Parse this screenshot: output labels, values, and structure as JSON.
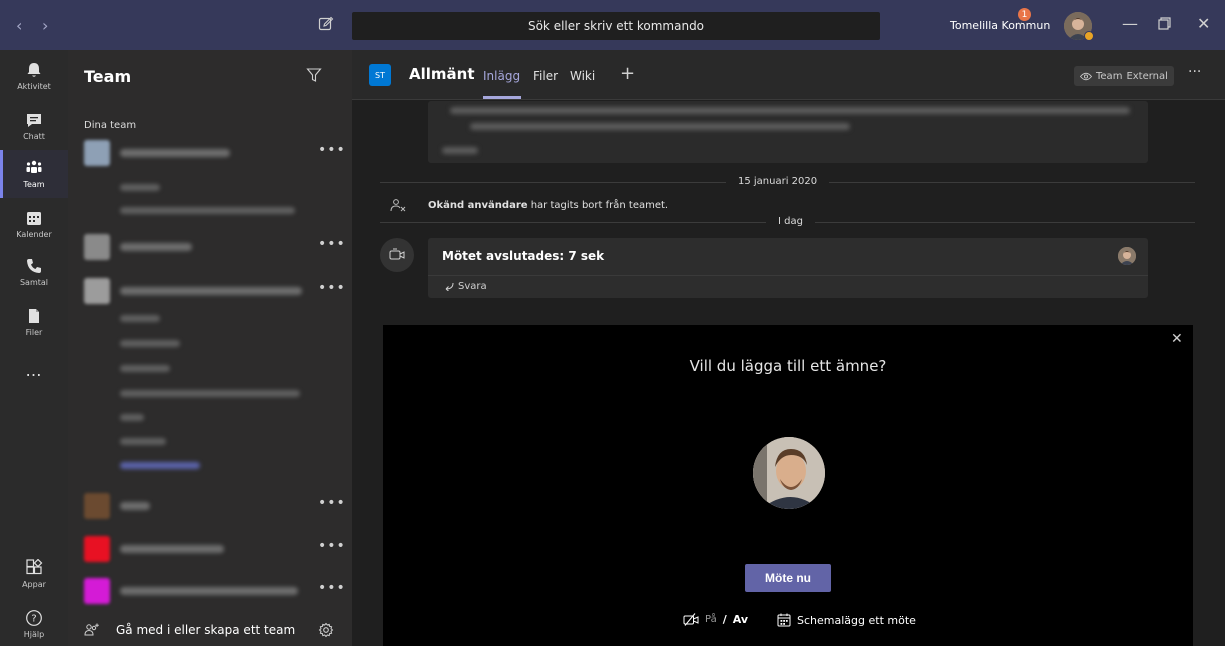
{
  "titlebar": {
    "search_placeholder": "Sök eller skriv ett kommando",
    "tenant": "Tomelilla Kommun",
    "notification_count": "1"
  },
  "rail": {
    "items": [
      {
        "label": "Aktivitet",
        "icon": "bell-icon"
      },
      {
        "label": "Chatt",
        "icon": "chat-icon"
      },
      {
        "label": "Team",
        "icon": "teams-icon"
      },
      {
        "label": "Kalender",
        "icon": "calendar-icon"
      },
      {
        "label": "Samtal",
        "icon": "phone-icon"
      },
      {
        "label": "Filer",
        "icon": "file-icon"
      },
      {
        "label": "…",
        "icon": "more-icon"
      }
    ],
    "bottom": [
      {
        "label": "Appar",
        "icon": "apps-icon"
      },
      {
        "label": "Hjälp",
        "icon": "help-icon"
      }
    ],
    "active": "Team"
  },
  "teams_pane": {
    "title": "Team",
    "section": "Dina team",
    "more": "•••",
    "join_label": "Gå med i eller skapa ett team",
    "team_tile_colors": [
      "#8ea0b5",
      "#8a8a8a",
      "#9c9c9c",
      "#6b4a30",
      "#e81123",
      "#d41bd6"
    ]
  },
  "channel": {
    "tile": "ST",
    "name": "Allmänt",
    "tabs": [
      "Inlägg",
      "Filer",
      "Wiki"
    ],
    "add_tab": "+",
    "team_label": "Team",
    "external_label": "External",
    "more": "···"
  },
  "conversation": {
    "date_divider": "15 januari 2020",
    "system_actor": "Okänd användare",
    "system_text": " har tagits bort från teamet.",
    "today_divider": "I dag",
    "meeting_title": "Mötet avslutades: 7 sek",
    "reply_label": "Svara"
  },
  "meet_panel": {
    "prompt": "Vill du lägga till ett ämne?",
    "meet_now": "Möte nu",
    "camera_on": "På",
    "camera_sep": "/",
    "camera_off": "Av",
    "schedule": "Schemalägg ett möte"
  },
  "colors": {
    "titlebar": "#36395a",
    "accent": "#6264a7",
    "accent_text": "#a6a7dc",
    "rail": "#2b2b2b",
    "pane": "#2d2c2c",
    "content": "#1f1f1f"
  }
}
